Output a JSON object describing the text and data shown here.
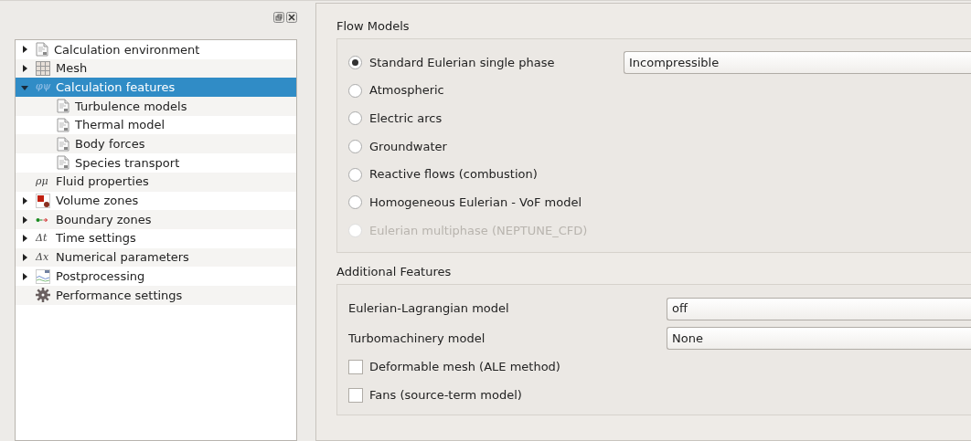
{
  "tree": [
    {
      "label": "Calculation environment",
      "kind": "doc",
      "expanded": false,
      "selected": false
    },
    {
      "label": "Mesh",
      "kind": "grid",
      "expanded": false,
      "selected": false
    },
    {
      "label": "Calculation features",
      "kind": "symbol",
      "symbol": "φψ",
      "expanded": true,
      "selected": true,
      "children": [
        {
          "label": "Turbulence models",
          "kind": "doc",
          "selected": false
        },
        {
          "label": "Thermal model",
          "kind": "doc",
          "selected": false
        },
        {
          "label": "Body forces",
          "kind": "doc",
          "selected": false
        },
        {
          "label": "Species transport",
          "kind": "doc",
          "selected": false
        }
      ]
    },
    {
      "label": "Fluid properties",
      "kind": "symbol",
      "symbol": "ρμ",
      "selected": false
    },
    {
      "label": "Volume zones",
      "kind": "zones",
      "expanded": false,
      "selected": false
    },
    {
      "label": "Boundary zones",
      "kind": "boundary",
      "expanded": false,
      "selected": false
    },
    {
      "label": "Time settings",
      "kind": "symbol",
      "symbol": "Δt",
      "expanded": false,
      "selected": false
    },
    {
      "label": "Numerical parameters",
      "kind": "symbol",
      "symbol": "Δx",
      "expanded": false,
      "selected": false
    },
    {
      "label": "Postprocessing",
      "kind": "plot",
      "expanded": false,
      "selected": false
    },
    {
      "label": "Performance settings",
      "kind": "gear",
      "selected": false
    }
  ],
  "flow_models": {
    "title": "Flow Models",
    "options": [
      {
        "label": "Standard Eulerian single phase",
        "selected": true,
        "disabled": false,
        "combo": "Incompressible"
      },
      {
        "label": "Atmospheric",
        "selected": false,
        "disabled": false
      },
      {
        "label": "Electric arcs",
        "selected": false,
        "disabled": false
      },
      {
        "label": "Groundwater",
        "selected": false,
        "disabled": false
      },
      {
        "label": "Reactive flows (combustion)",
        "selected": false,
        "disabled": false
      },
      {
        "label": "Homogeneous Eulerian - VoF model",
        "selected": false,
        "disabled": false
      },
      {
        "label": "Eulerian multiphase (NEPTUNE_CFD)",
        "selected": false,
        "disabled": true
      }
    ]
  },
  "additional_features": {
    "title": "Additional Features",
    "rows": [
      {
        "kind": "combo",
        "label": "Eulerian-Lagrangian model",
        "value": "off"
      },
      {
        "kind": "combo",
        "label": "Turbomachinery model",
        "value": "None"
      },
      {
        "kind": "checkbox",
        "label": "Deformable mesh (ALE method)",
        "checked": false
      },
      {
        "kind": "checkbox",
        "label": "Fans (source-term model)",
        "checked": false
      }
    ]
  }
}
